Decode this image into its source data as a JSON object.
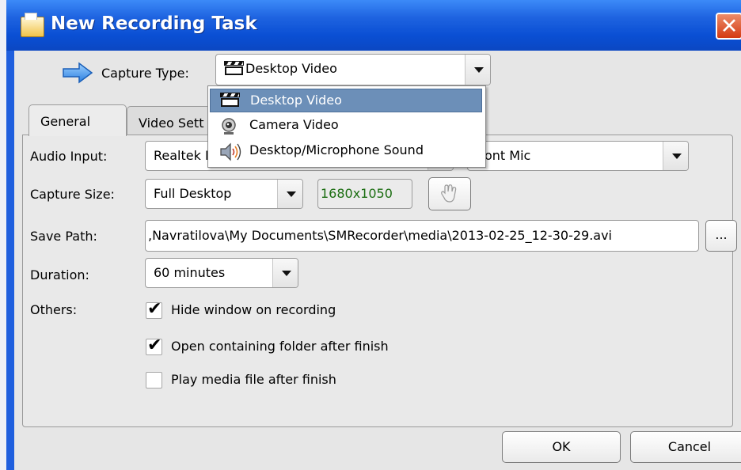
{
  "window": {
    "title": "New Recording Task",
    "close_glyph": "✕"
  },
  "capture_type": {
    "label": "Capture Type:",
    "value": "Desktop Video",
    "icon": "arrow-right-icon",
    "options": [
      {
        "label": "Desktop Video",
        "icon": "clapperboard-icon",
        "selected": true
      },
      {
        "label": "Camera Video",
        "icon": "webcam-icon",
        "selected": false
      },
      {
        "label": "Desktop/Microphone Sound",
        "icon": "speaker-icon",
        "selected": false
      }
    ]
  },
  "tabs": [
    {
      "label": "General",
      "active": true
    },
    {
      "label": "Video Sett",
      "active": false
    }
  ],
  "general": {
    "audio_input": {
      "label": "Audio Input:",
      "device_visible": "Realtek H",
      "mic_visible": "ont Mic"
    },
    "capture_size": {
      "label": "Capture Size:",
      "value": "Full Desktop",
      "resolution": "1680x1050",
      "pick_icon": "hand-pointer-icon"
    },
    "save_path": {
      "label": "Save Path:",
      "value": ",Navratilova\\My Documents\\SMRecorder\\media\\2013-02-25_12-30-29.avi",
      "browse_label": "..."
    },
    "duration": {
      "label": "Duration:",
      "value": "60 minutes"
    },
    "others": {
      "label": "Others:",
      "options": [
        {
          "label": "Hide window on recording",
          "checked": true
        },
        {
          "label": "Open containing folder after finish",
          "checked": true
        },
        {
          "label": "Play media file after finish",
          "checked": false
        }
      ]
    }
  },
  "buttons": {
    "ok": "OK",
    "cancel": "Cancel"
  },
  "colors": {
    "title_bar": "#0a4fd4",
    "selection": "#6c8fb8",
    "resolution_text": "#1c6e12",
    "close_button": "#d43a12"
  }
}
